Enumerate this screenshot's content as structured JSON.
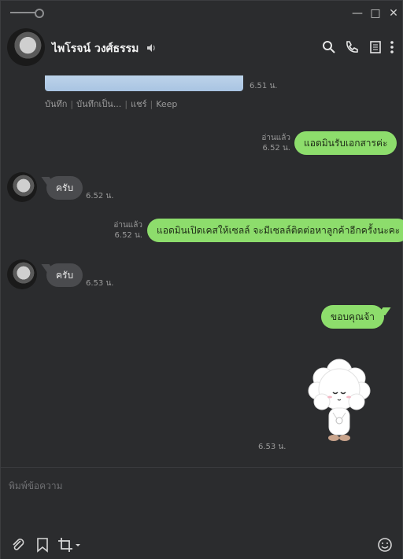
{
  "contact": {
    "name": "ไพโรจน์ วงศ์ธรรม"
  },
  "composer": {
    "placeholder": "พิมพ์ข้อความ"
  },
  "file_message": {
    "time": "6.51 น.",
    "actions": [
      "บันทึก",
      "บันทึกเป็น...",
      "แชร์",
      "Keep"
    ]
  },
  "messages": [
    {
      "dir": "out",
      "read": "อ่านแล้ว",
      "time": "6.52 น.",
      "text": "แอดมินรับเอกสารค่ะ"
    },
    {
      "dir": "in",
      "time": "6.52 น.",
      "text": "ครับ"
    },
    {
      "dir": "out",
      "read": "อ่านแล้ว",
      "time": "6.52 น.",
      "text": "แอดมินเปิดเคสให้เซลล์ จะมีเซลล์ติดต่อหาลูกค้าอีกครั้งนะคะ"
    },
    {
      "dir": "in",
      "time": "6.53 น.",
      "text": "ครับ"
    },
    {
      "dir": "out",
      "text": "ขอบคุณจ้า"
    }
  ],
  "sticker": {
    "time": "6.53 น."
  },
  "colors": {
    "bg": "#2b2c2e",
    "out_bubble": "#8ddd6c",
    "in_bubble": "#4a4b4e"
  },
  "icons": {
    "header": [
      "search-icon",
      "phone-icon",
      "notes-icon",
      "more-vertical-icon"
    ],
    "toolbar": [
      "paperclip-icon",
      "bookmark-icon",
      "crop-icon",
      "emoji-icon"
    ]
  }
}
